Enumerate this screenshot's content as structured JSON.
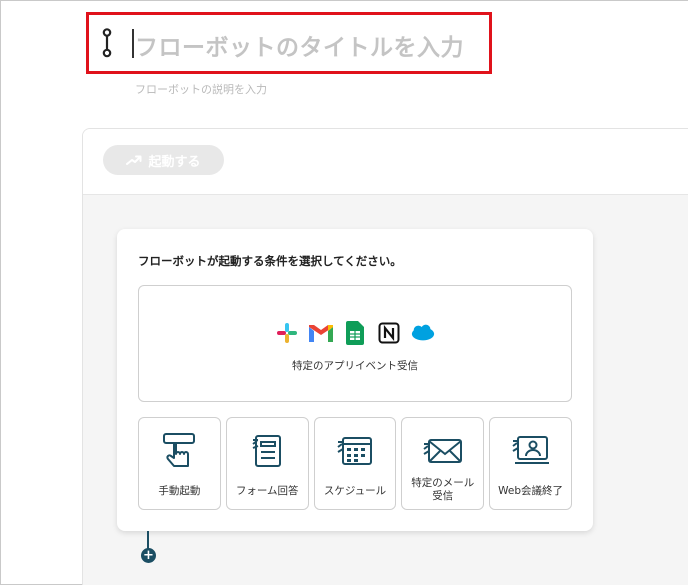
{
  "header": {
    "title_placeholder": "フローボットのタイトルを入力",
    "description_placeholder": "フローボットの説明を入力"
  },
  "toolbar": {
    "start_label": "起動する"
  },
  "trigger_card": {
    "heading": "フローボットが起動する条件を選択してください。",
    "app_event": {
      "label": "特定のアプリイベント受信",
      "icons": [
        "slack-icon",
        "gmail-icon",
        "google-sheets-icon",
        "notion-icon",
        "salesforce-icon"
      ]
    },
    "options": [
      {
        "label": "手動起動",
        "icon": "manual-start-icon"
      },
      {
        "label": "フォーム回答",
        "icon": "form-icon"
      },
      {
        "label": "スケジュール",
        "icon": "schedule-icon"
      },
      {
        "label": "特定のメール\n受信",
        "icon": "mail-icon"
      },
      {
        "label": "Web会議終了",
        "icon": "web-meeting-icon"
      }
    ]
  },
  "colors": {
    "accent": "#1b4e63",
    "highlight": "#e0121b",
    "disabled": "#e8e8e8"
  }
}
